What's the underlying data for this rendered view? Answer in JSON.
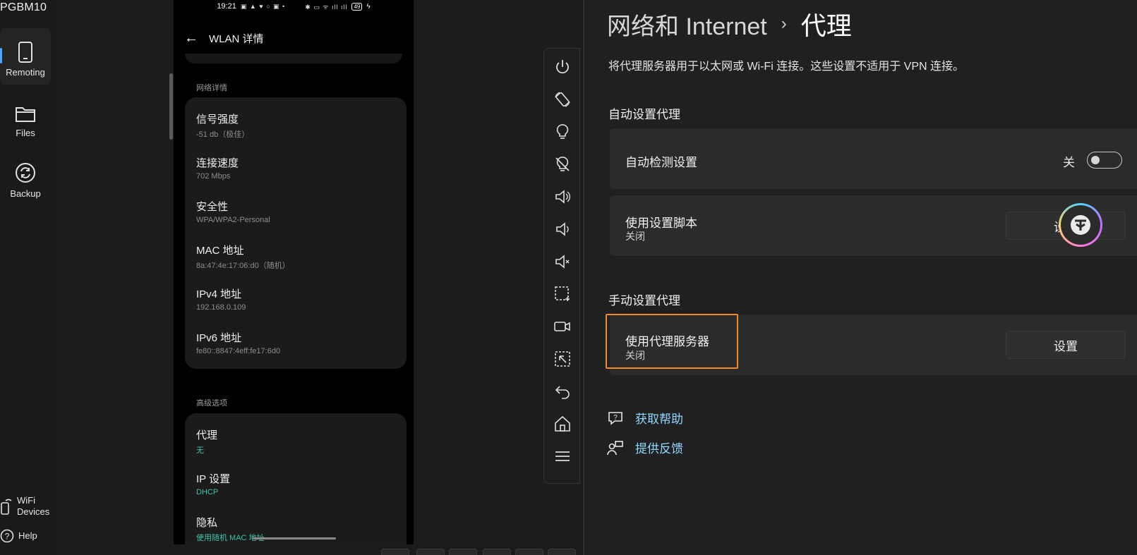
{
  "app": {
    "device_name": "PGBM10",
    "nav": [
      {
        "id": "remoting",
        "label": "Remoting",
        "icon": "phone-icon",
        "active": true
      },
      {
        "id": "files",
        "label": "Files",
        "icon": "folder-icon",
        "active": false
      },
      {
        "id": "backup",
        "label": "Backup",
        "icon": "sync-icon",
        "active": false
      }
    ],
    "bottom_links": [
      {
        "id": "wifi-devices",
        "label": "WiFi\nDevices",
        "icon": "wifi-device-icon"
      },
      {
        "id": "help",
        "label": "Help",
        "icon": "help-icon"
      }
    ]
  },
  "phone": {
    "status_time": "19:21",
    "status_battery": "49",
    "header_title": "WLAN 详情",
    "network_section_label": "网络详情",
    "network_details": [
      {
        "key": "信号强度",
        "value": "-51 db（极佳）"
      },
      {
        "key": "连接速度",
        "value": "702 Mbps"
      },
      {
        "key": "安全性",
        "value": "WPA/WPA2-Personal"
      },
      {
        "key": "MAC 地址",
        "value": "8a:47:4e:17:06:d0（随机）"
      },
      {
        "key": "IPv4 地址",
        "value": "192.168.0.109"
      },
      {
        "key": "IPv6 地址",
        "value": "fe80::8847:4eff:fe17:6d0"
      }
    ],
    "advanced_section_label": "高级选项",
    "advanced": [
      {
        "key": "代理",
        "value": "无"
      },
      {
        "key": "IP 设置",
        "value": "DHCP"
      },
      {
        "key": "隐私",
        "value": "使用随机 MAC 地址"
      }
    ]
  },
  "toolbar": {
    "buttons": [
      "power-icon",
      "rotate-icon",
      "light-on-icon",
      "light-off-icon",
      "volume-up-icon",
      "volume-down-icon",
      "mute-icon",
      "screenshot-region-icon",
      "record-icon",
      "select-region-icon",
      "back-icon",
      "home-icon",
      "menu-icon"
    ]
  },
  "settings": {
    "breadcrumb_parent": "网络和 Internet",
    "breadcrumb_sep": "›",
    "breadcrumb_current": "代理",
    "description": "将代理服务器用于以太网或 Wi-Fi 连接。这些设置不适用于 VPN 连接。",
    "auto_group_title": "自动设置代理",
    "auto_detect_label": "自动检测设置",
    "auto_detect_state": "关",
    "auto_detect_on": false,
    "script_label": "使用设置脚本",
    "script_status": "关闭",
    "script_button": "设置",
    "manual_group_title": "手动设置代理",
    "proxy_server_label": "使用代理服务器",
    "proxy_server_status": "关闭",
    "proxy_server_button": "设置",
    "get_help": "获取帮助",
    "feedback": "提供反馈",
    "highlight_color": "#f08a24",
    "link_color": "#8fd8ff"
  }
}
